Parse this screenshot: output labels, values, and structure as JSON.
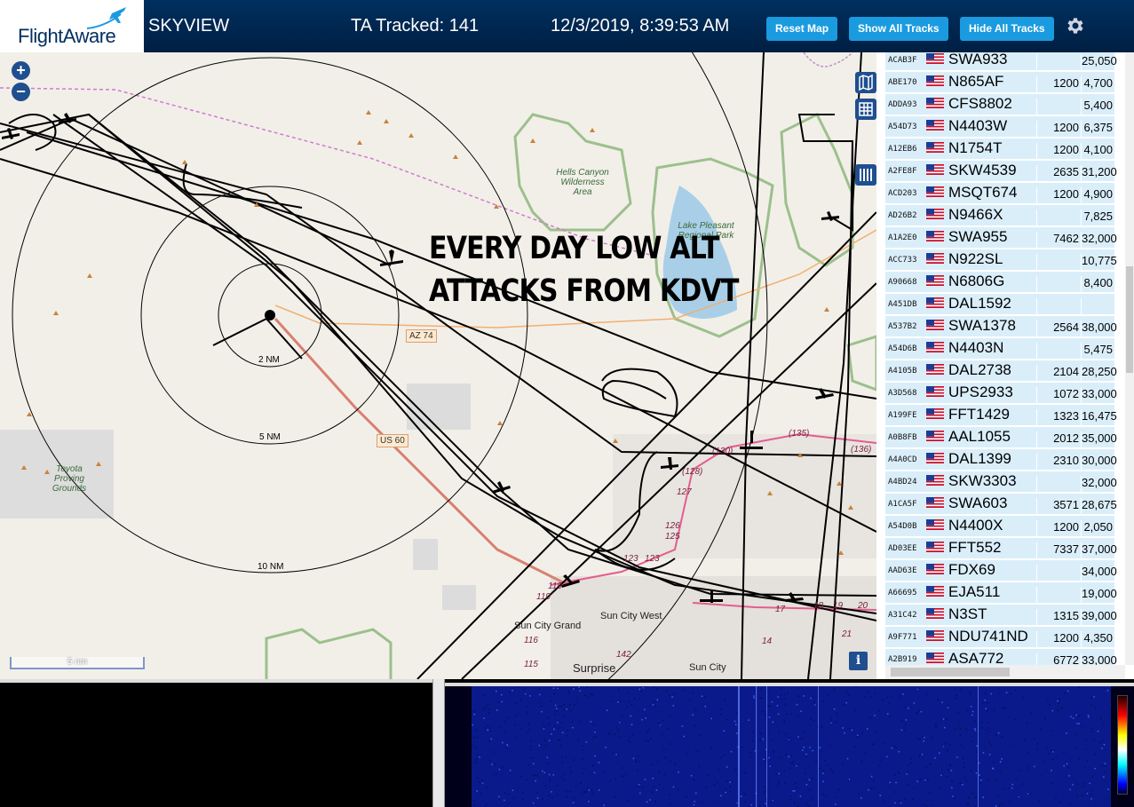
{
  "header": {
    "logo": "FlightAware",
    "app_name": "SKYVIEW",
    "tracked_label": "TA Tracked: 141",
    "datetime": "12/3/2019, 8:39:53 AM",
    "buttons": {
      "reset": "Reset Map",
      "show_all": "Show All Tracks",
      "hide_all": "Hide All Tracks"
    },
    "settings_icon": "gear-icon"
  },
  "map": {
    "overlay_text": [
      "EVERY DAY LOW ALT",
      "ATTACKS FROM KDVT"
    ],
    "ring_labels": [
      "2 NM",
      "5 NM",
      "10 NM"
    ],
    "scale_label": "5 nm",
    "places": [
      "Sun City Grand",
      "Sun City West",
      "Surprise",
      "Sun City"
    ],
    "parks": [
      "Hells Canyon Wilderness Area",
      "Lake Pleasant Regional Park",
      "Toyota Proving Grounds"
    ],
    "road_shields": [
      "AZ 74",
      "US 60"
    ],
    "route_numbers": [
      "(135)",
      "(136)",
      "(130)",
      "(128)",
      "127",
      "126",
      "125",
      "123",
      "123",
      "119",
      "119",
      "116",
      "115",
      "142",
      "14",
      "17",
      "18",
      "19",
      "20",
      "21"
    ],
    "controls": {
      "zoom_in": "+",
      "zoom_out": "−",
      "info": "i"
    },
    "colors": {
      "background": "#f2efe9",
      "track": "#000000",
      "park": "#9cc08c",
      "water": "#a9cfe8",
      "route": "#e35d8f"
    }
  },
  "aircraft_table": {
    "rows": [
      {
        "hex": "ACAB3F",
        "callsign": "SWA933",
        "squawk": "",
        "altitude": "25,050"
      },
      {
        "hex": "ABE170",
        "callsign": "N865AF",
        "squawk": "1200",
        "altitude": "4,700"
      },
      {
        "hex": "ADDA93",
        "callsign": "CFS8802",
        "squawk": "",
        "altitude": "5,400"
      },
      {
        "hex": "A54D73",
        "callsign": "N4403W",
        "squawk": "1200",
        "altitude": "6,375"
      },
      {
        "hex": "A12EB6",
        "callsign": "N1754T",
        "squawk": "1200",
        "altitude": "4,100"
      },
      {
        "hex": "A2FE8F",
        "callsign": "SKW4539",
        "squawk": "2635",
        "altitude": "31,200"
      },
      {
        "hex": "ACD203",
        "callsign": "MSQT674",
        "squawk": "1200",
        "altitude": "4,900"
      },
      {
        "hex": "AD26B2",
        "callsign": "N9466X",
        "squawk": "",
        "altitude": "7,825"
      },
      {
        "hex": "A1A2E0",
        "callsign": "SWA955",
        "squawk": "7462",
        "altitude": "32,000"
      },
      {
        "hex": "ACC733",
        "callsign": "N922SL",
        "squawk": "",
        "altitude": "10,775"
      },
      {
        "hex": "A90668",
        "callsign": "N6806G",
        "squawk": "",
        "altitude": "8,400"
      },
      {
        "hex": "A451DB",
        "callsign": "DAL1592",
        "squawk": "",
        "altitude": ""
      },
      {
        "hex": "A537B2",
        "callsign": "SWA1378",
        "squawk": "2564",
        "altitude": "38,000"
      },
      {
        "hex": "A54D6B",
        "callsign": "N4403N",
        "squawk": "",
        "altitude": "5,475"
      },
      {
        "hex": "A4105B",
        "callsign": "DAL2738",
        "squawk": "2104",
        "altitude": "28,250"
      },
      {
        "hex": "A3D568",
        "callsign": "UPS2933",
        "squawk": "1072",
        "altitude": "33,000"
      },
      {
        "hex": "A199FE",
        "callsign": "FFT1429",
        "squawk": "1323",
        "altitude": "16,475"
      },
      {
        "hex": "A0B8FB",
        "callsign": "AAL1055",
        "squawk": "2012",
        "altitude": "35,000"
      },
      {
        "hex": "A4A0CD",
        "callsign": "DAL1399",
        "squawk": "2310",
        "altitude": "30,000"
      },
      {
        "hex": "A4BD24",
        "callsign": "SKW3303",
        "squawk": "",
        "altitude": "32,000"
      },
      {
        "hex": "A1CA5F",
        "callsign": "SWA603",
        "squawk": "3571",
        "altitude": "28,675"
      },
      {
        "hex": "A54D0B",
        "callsign": "N4400X",
        "squawk": "1200",
        "altitude": "2,050"
      },
      {
        "hex": "AD03EE",
        "callsign": "FFT552",
        "squawk": "7337",
        "altitude": "37,000"
      },
      {
        "hex": "AAD63E",
        "callsign": "FDX69",
        "squawk": "",
        "altitude": "34,000"
      },
      {
        "hex": "A66695",
        "callsign": "EJA511",
        "squawk": "",
        "altitude": "19,000"
      },
      {
        "hex": "A31C42",
        "callsign": "N3ST",
        "squawk": "1315",
        "altitude": "39,000"
      },
      {
        "hex": "A9F771",
        "callsign": "NDU741ND",
        "squawk": "1200",
        "altitude": "4,350"
      },
      {
        "hex": "A2B919",
        "callsign": "ASA772",
        "squawk": "6772",
        "altitude": "33,000"
      }
    ]
  }
}
